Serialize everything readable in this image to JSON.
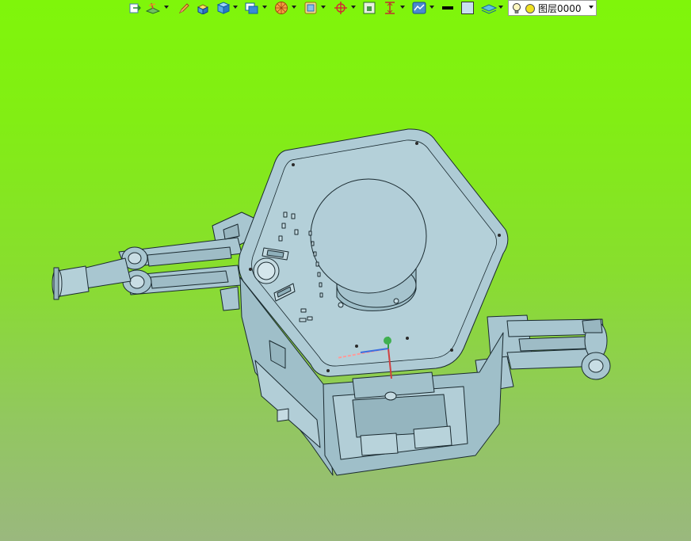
{
  "toolbar": {
    "icons": [
      "exit-sketch-icon",
      "sketch-plane-icon",
      "pencil-icon",
      "extrude-icon",
      "solid-box-icon",
      "view-cube-icon",
      "render-style-icon",
      "section-view-icon",
      "origin-crosshair-icon",
      "fit-view-icon",
      "dimension-icon",
      "display-settings-icon",
      "line-color-icon",
      "face-color-icon",
      "layer-icon",
      "lightbulb-icon",
      "layer-color-icon"
    ],
    "layer_combo": {
      "current_layer": "图层0000"
    }
  },
  "viewport": {
    "background_top": "#7ff60a",
    "background_bottom": "#9ab87e",
    "model_color": "#a9c8d2",
    "edge_color": "#1a2a30"
  }
}
